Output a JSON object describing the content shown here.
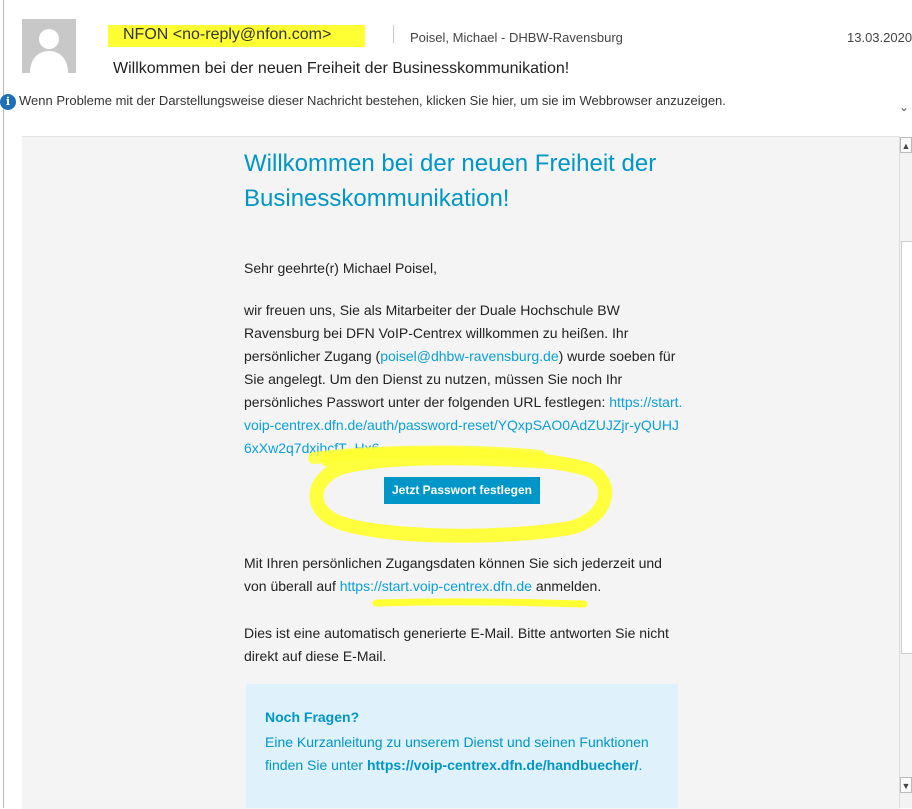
{
  "header": {
    "sender": "NFON <no-reply@nfon.com>",
    "recipient": "Poisel, Michael  - DHBW-Ravensburg",
    "date": "13.03.2020",
    "subject": "Willkommen bei der neuen Freiheit der Businesskommunikation!",
    "info_bar": "Wenn Probleme mit der Darstellungsweise dieser Nachricht bestehen, klicken Sie hier, um sie im Webbrowser anzuzeigen."
  },
  "email": {
    "title": "Willkommen bei der neuen Freiheit der Businesskommunikation!",
    "greeting": "Sehr geehrte(r) Michael Poisel,",
    "p1_a": "wir freuen uns, Sie als Mitarbeiter der Duale Hochschule BW Ravensburg bei DFN VoIP-Centrex willkommen zu heißen. Ihr persönlicher Zugang (",
    "p1_email": "poisel@dhbw-ravensburg.de",
    "p1_b": ") wurde soeben für Sie angelegt. Um den Dienst zu nutzen, müssen Sie noch Ihr persönliches Passwort unter der folgenden URL festlegen: ",
    "p1_url": "https://start.voip-centrex.dfn.de/auth/password-reset/YQxpSAO0AdZUJZjr-yQUHJ6xXw2q7dxjhcfT_Hx6",
    "p1_end": ".",
    "cta": "Jetzt Passwort festlegen",
    "p2_a": "Mit Ihren persönlichen Zugangsdaten können Sie sich jederzeit und von überall auf ",
    "p2_url": "https://start.voip-centrex.dfn.de",
    "p2_b": " anmelden.",
    "p3": "Dies ist eine automatisch generierte E-Mail. Bitte antworten Sie nicht direkt auf diese E-Mail.",
    "faq_heading": "Noch Fragen?",
    "faq_a": "Eine Kurzanleitung zu unserem Dienst und seinen Funktionen finden Sie unter ",
    "faq_url": "https://voip-centrex.dfn.de/handbuecher/",
    "faq_end": "."
  },
  "colors": {
    "accent": "#0096c8",
    "highlight": "#ffff33"
  },
  "icons": {
    "info": "info-icon",
    "avatar": "person-avatar-icon",
    "expand": "chevron-down-icon"
  }
}
